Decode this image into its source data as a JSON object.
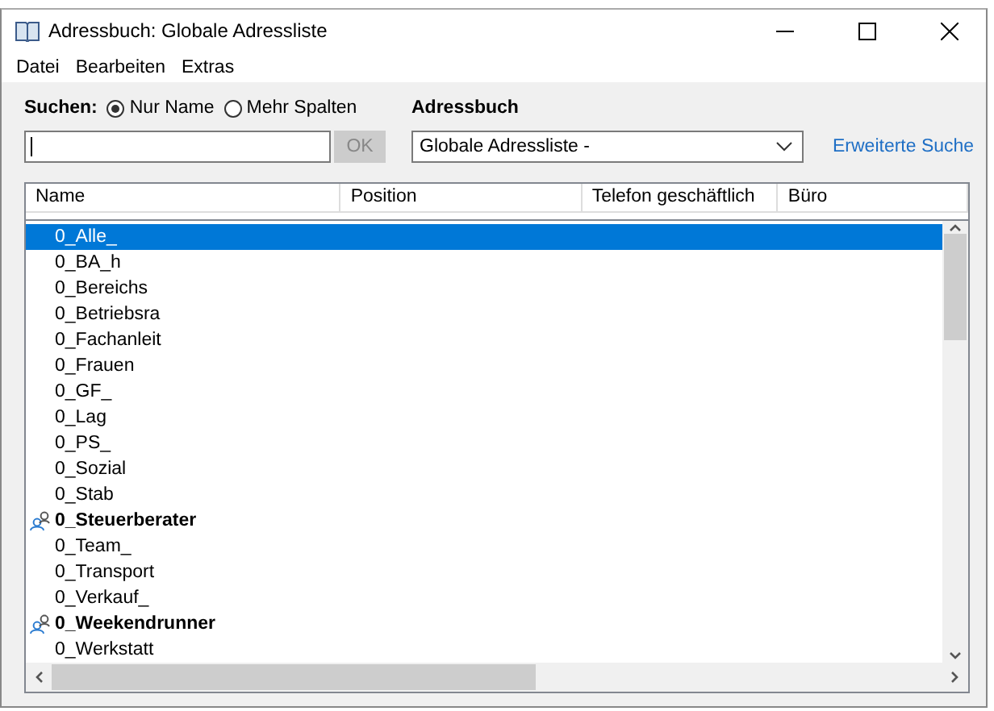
{
  "window": {
    "title": "Adressbuch: Globale Adressliste"
  },
  "menu": [
    "Datei",
    "Bearbeiten",
    "Extras"
  ],
  "search": {
    "label": "Suchen:",
    "options": [
      {
        "label": "Nur Name",
        "selected": true
      },
      {
        "label": "Mehr Spalten",
        "selected": false
      }
    ],
    "ok": "OK"
  },
  "address_book": {
    "label": "Adressbuch",
    "value": "Globale Adressliste -",
    "advanced_link": "Erweiterte Suche"
  },
  "table": {
    "columns": [
      "Name",
      "Position",
      "Telefon geschäftlich",
      "Büro"
    ],
    "rows": [
      {
        "name": "0_Alle_",
        "kind": "contact",
        "selected": true
      },
      {
        "name": "0_BA_h",
        "kind": "contact",
        "selected": false
      },
      {
        "name": "0_Bereichs",
        "kind": "contact",
        "selected": false
      },
      {
        "name": "0_Betriebsra",
        "kind": "contact",
        "selected": false
      },
      {
        "name": "0_Fachanleit",
        "kind": "contact",
        "selected": false
      },
      {
        "name": "0_Frauen",
        "kind": "contact",
        "selected": false
      },
      {
        "name": "0_GF_",
        "kind": "contact",
        "selected": false
      },
      {
        "name": "0_Lag",
        "kind": "contact",
        "selected": false
      },
      {
        "name": "0_PS_",
        "kind": "contact",
        "selected": false
      },
      {
        "name": "0_Sozial",
        "kind": "contact",
        "selected": false
      },
      {
        "name": "0_Stab",
        "kind": "contact",
        "selected": false
      },
      {
        "name": "0_Steuerberater",
        "kind": "group",
        "selected": false
      },
      {
        "name": "0_Team_",
        "kind": "contact",
        "selected": false
      },
      {
        "name": "0_Transport",
        "kind": "contact",
        "selected": false
      },
      {
        "name": "0_Verkauf_",
        "kind": "contact",
        "selected": false
      },
      {
        "name": "0_Weekendrunner",
        "kind": "group",
        "selected": false
      },
      {
        "name": "0_Werkstatt",
        "kind": "contact",
        "selected": false
      }
    ]
  }
}
